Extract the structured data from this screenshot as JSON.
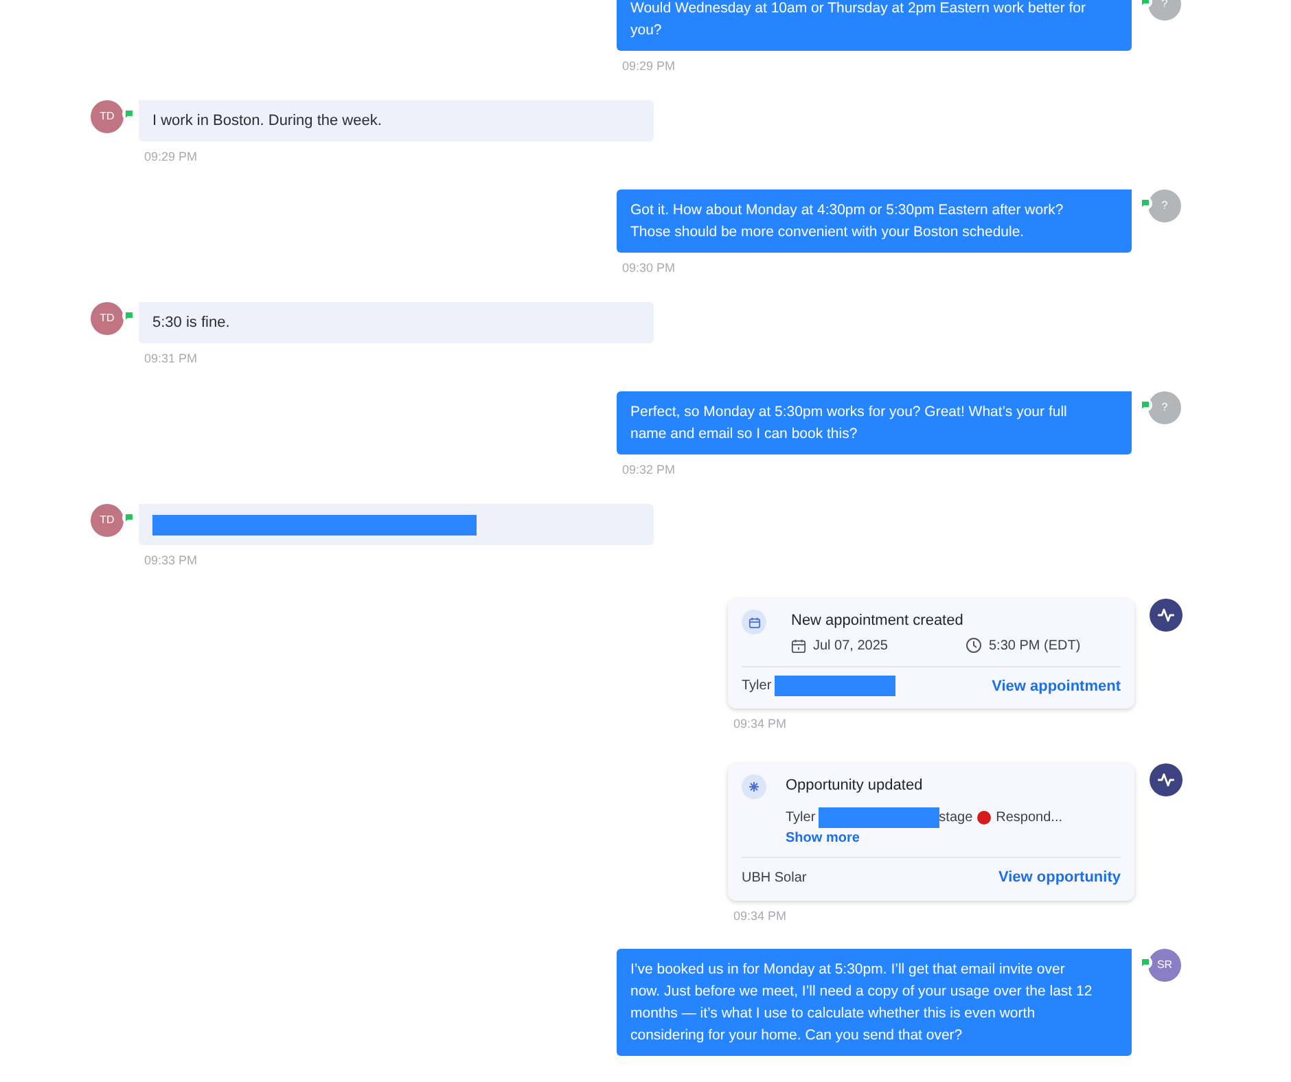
{
  "messages": [
    {
      "kind": "outgoing",
      "text": "Would Wednesday at 10am or Thursday at 2pm Eastern work better for you?",
      "time": "09:29 PM",
      "avatar": {
        "initials": "?",
        "color": "#b3b6b9"
      }
    },
    {
      "kind": "incoming",
      "text": "I work in Boston. During the week.",
      "time": "09:29 PM",
      "avatar": {
        "initials": "TD",
        "color": "#c17482"
      }
    },
    {
      "kind": "outgoing",
      "text": "Got it. How about Monday at 4:30pm or 5:30pm Eastern after work? Those should be more convenient with your Boston schedule.",
      "time": "09:30 PM",
      "avatar": {
        "initials": "?",
        "color": "#b3b6b9"
      }
    },
    {
      "kind": "incoming",
      "text": "5:30 is fine.",
      "time": "09:31 PM",
      "avatar": {
        "initials": "TD",
        "color": "#c17482"
      }
    },
    {
      "kind": "outgoing",
      "text": "Perfect, so Monday at 5:30pm works for you? Great! What’s your full name and email so I can book this?",
      "time": "09:32 PM",
      "avatar": {
        "initials": "?",
        "color": "#b3b6b9"
      }
    },
    {
      "kind": "incoming",
      "redacted": true,
      "time": "09:33 PM",
      "avatar": {
        "initials": "TD",
        "color": "#c17482"
      }
    },
    {
      "kind": "appointment",
      "title": "New appointment created",
      "date": "Jul 07, 2025",
      "slot": "5:30 PM (EDT)",
      "contact": "Tyler",
      "link": "View appointment",
      "time": "09:34 PM"
    },
    {
      "kind": "opportunity",
      "title": "Opportunity updated",
      "contact": "Tyler",
      "detail": "stage",
      "status": "Respond...",
      "show_more": "Show more",
      "company": "UBH Solar",
      "link": "View opportunity",
      "time": "09:34 PM"
    },
    {
      "kind": "outgoing",
      "text": "I’ve booked us in for Monday at 5:30pm. I’ll get that email invite over now. Just before we meet, I’ll need a copy of your usage over the last 12 months — it’s what I use to calculate whether this is even worth considering for your home. Can you send that over?",
      "avatar": {
        "initials": "SR",
        "color": "#8a7ec4"
      }
    }
  ]
}
